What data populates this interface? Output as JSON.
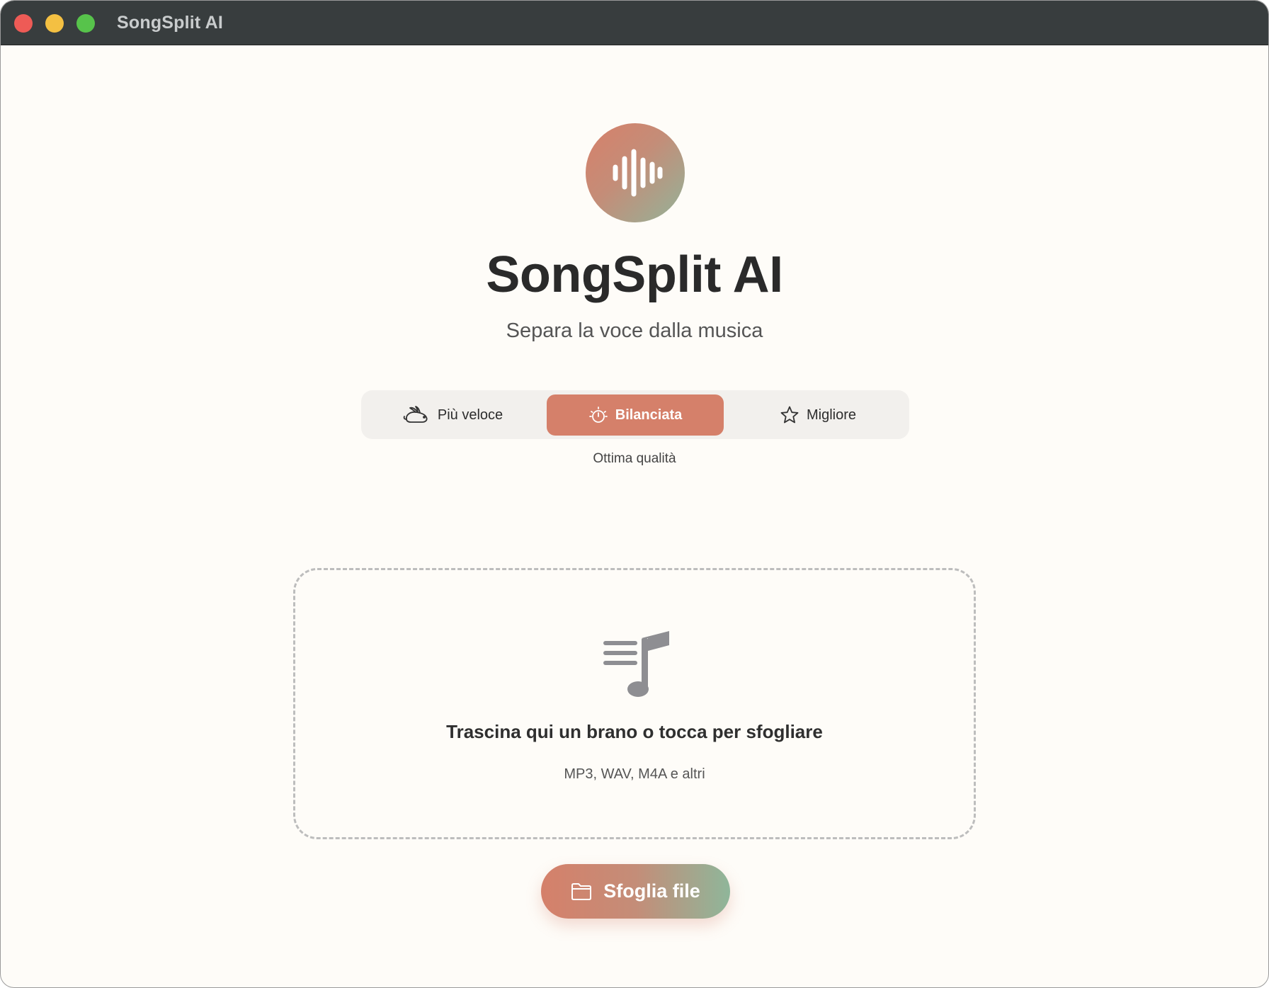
{
  "window": {
    "title": "SongSplit AI"
  },
  "header": {
    "logo_icon": "waveform-icon",
    "title": "SongSplit AI",
    "subtitle": "Separa la voce dalla musica"
  },
  "quality": {
    "options": [
      {
        "label": "Più veloce",
        "icon": "rabbit-icon",
        "selected": false
      },
      {
        "label": "Bilanciata",
        "icon": "timer-icon",
        "selected": true
      },
      {
        "label": "Migliore",
        "icon": "star-icon",
        "selected": false
      }
    ],
    "caption": "Ottima qualità"
  },
  "dropzone": {
    "icon": "music-list-icon",
    "title": "Trascina qui un brano o tocca per sfogliare",
    "formats": "MP3, WAV, M4A e altri"
  },
  "browse": {
    "label": "Sfoglia file",
    "icon": "folder-icon"
  },
  "colors": {
    "accent": "#d5806a",
    "accent_green": "#8fb69a",
    "background": "#fefcf8",
    "titlebar": "#383d3e"
  }
}
